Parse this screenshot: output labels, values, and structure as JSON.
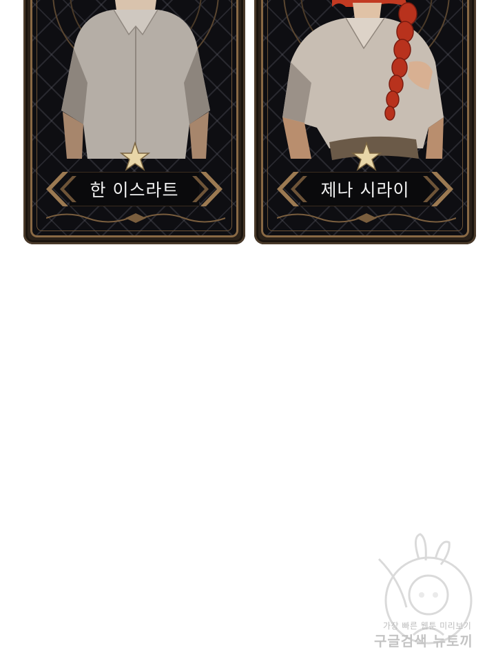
{
  "cards": [
    {
      "name": "한 이스라트"
    },
    {
      "name": "제나 시라이"
    }
  ],
  "watermark": {
    "line1": "가장 빠른 웹툰 미리보기",
    "line2": "구글검색 뉴토끼"
  },
  "colors": {
    "frame_gold": "#8a6a45",
    "card_bg": "#0e0e12",
    "shirt": "#b8b0a6",
    "hair_red": "#c23a22"
  }
}
